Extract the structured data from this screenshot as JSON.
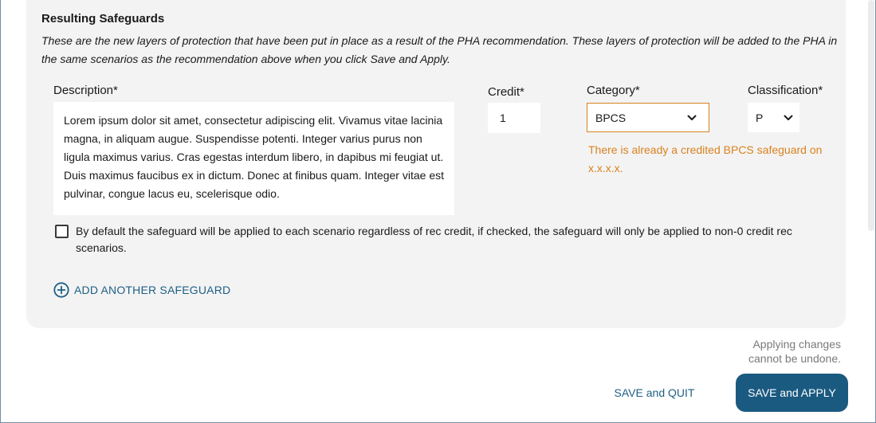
{
  "section": {
    "title": "Resulting Safeguards",
    "description": "These are the new layers of protection that have been put in place as a result of the PHA recommendation. These layers of protection will be added to the PHA in the same scenarios as the recommendation above when you click Save and Apply."
  },
  "fields": {
    "description_label": "Description*",
    "description_value": "Lorem ipsum dolor sit amet, consectetur adipiscing elit. Vivamus vitae lacinia magna, in aliquam augue. Suspendisse potenti. Integer varius purus non ligula maximus varius. Cras egestas interdum libero, in dapibus mi feugiat ut. Duis maximus faucibus ex in dictum. Donec at finibus quam. Integer vitae est pulvinar, congue lacus eu, scelerisque odio.",
    "credit_label": "Credit*",
    "credit_value": "1",
    "category_label": "Category*",
    "category_value": "BPCS",
    "classification_label": "Classification*",
    "classification_value": "P",
    "category_warning": "There is already a credited BPCS safeguard on x.x.x.x."
  },
  "checkbox": {
    "label": "By default the safeguard will be applied to each scenario regardless of rec credit, if checked, the safeguard will only be applied to non-0 credit rec scenarios.",
    "checked": false
  },
  "add_safeguard": {
    "label": "ADD ANOTHER SAFEGUARD",
    "icon": "plus-circle-icon"
  },
  "footer": {
    "note": "Applying changes cannot be undone.",
    "save_quit_label": "SAVE and QUIT",
    "save_apply_label": "SAVE and APPLY"
  },
  "colors": {
    "primary": "#1b5a80",
    "link": "#1e5f86",
    "warning": "#d9821f",
    "panel_bg": "#f3f3f3"
  }
}
